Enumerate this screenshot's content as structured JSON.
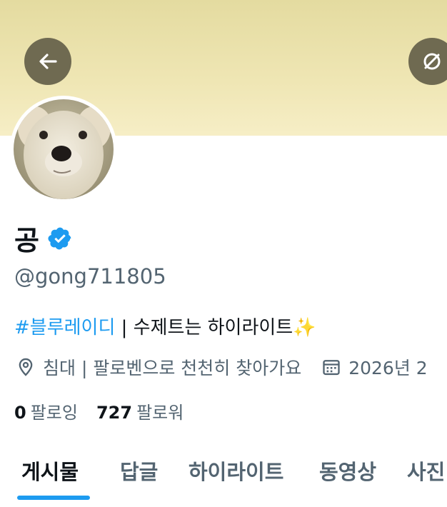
{
  "profile": {
    "display_name": "공",
    "handle": "@gong711805",
    "bio_hashtag": "#블루레이디",
    "bio_text": " | 수제트는 하이라이트",
    "bio_emoji": "✨",
    "location": "침대 | 팔로벤으로 천천히 찾아가요",
    "joined": "2026년 2",
    "following_count": "0",
    "following_label": "팔로잉",
    "followers_count": "727",
    "followers_label": "팔로워"
  },
  "tabs": [
    {
      "label": "게시물",
      "active": true
    },
    {
      "label": "답글"
    },
    {
      "label": "하이라이트"
    },
    {
      "label": "동영상"
    },
    {
      "label": "사진"
    }
  ],
  "icons": {
    "back": "arrow-left-icon",
    "right": "unavailable-icon",
    "verified": "verified-badge-icon",
    "location": "location-pin-icon",
    "calendar": "calendar-icon"
  },
  "colors": {
    "accent": "#1d9bf0",
    "banner": "#ece3ae",
    "overlay_button": "#6f6a51",
    "secondary_text": "#536471"
  }
}
